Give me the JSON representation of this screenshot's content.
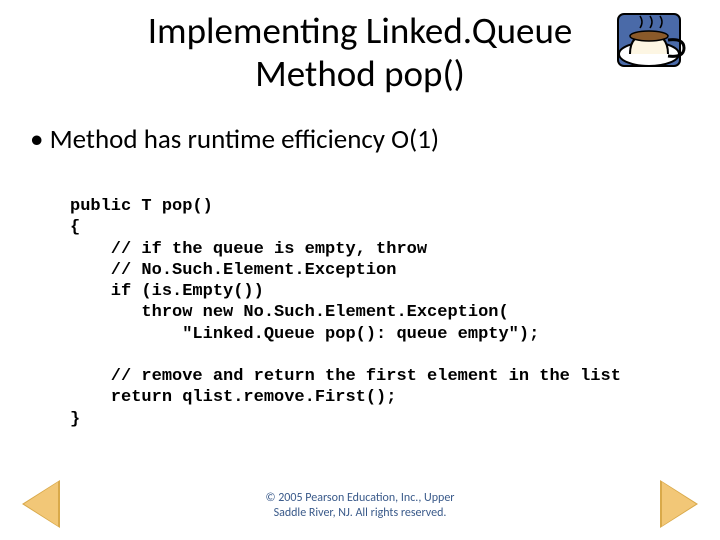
{
  "title_line1": "Implementing Linked.Queue",
  "title_line2": "Method  pop()",
  "bullet1": "Method has runtime efficiency O(1)",
  "code": "public T pop()\n{\n    // if the queue is empty, throw\n    // No.Such.Element.Exception\n    if (is.Empty())\n       throw new No.Such.Element.Exception(\n           \"Linked.Queue pop(): queue empty\");\n\n    // remove and return the first element in the list\n    return qlist.remove.First();\n}",
  "footer_line1": "© 2005 Pearson Education, Inc., Upper",
  "footer_line2": "Saddle River, NJ.  All rights reserved.",
  "icons": {
    "teacup": "teacup-icon",
    "prev": "arrow-left-icon",
    "next": "arrow-right-icon"
  }
}
